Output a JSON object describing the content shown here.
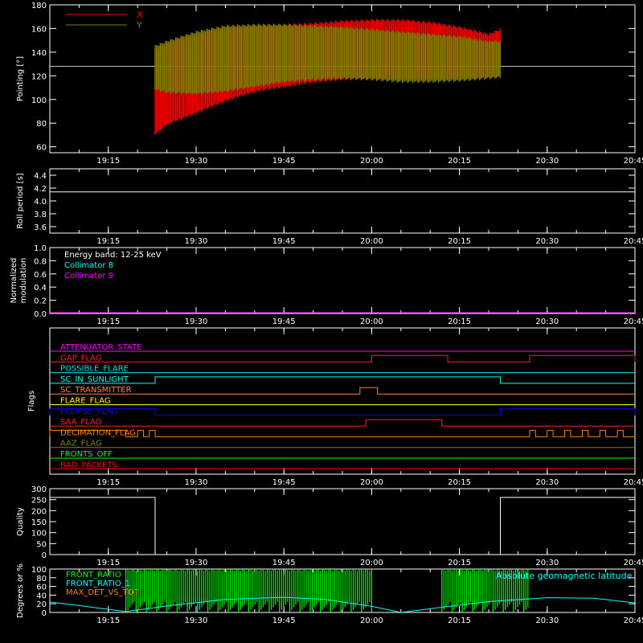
{
  "colors": {
    "background": "#000000",
    "axes": "#ffffff",
    "x_series": "#ff0000",
    "y_series": "#808000",
    "cyan": "#00ffff",
    "magenta": "#ff00ff",
    "green": "#00ff00",
    "orange": "#ff8000"
  },
  "time_axis": {
    "ticks": [
      "19:15",
      "19:30",
      "19:45",
      "20:00",
      "20:15",
      "20:30",
      "20:45"
    ]
  },
  "chart_data": [
    {
      "type": "area",
      "id": "pointing",
      "ylabel": "Pointing [°]",
      "ylim": [
        55,
        180
      ],
      "yticks": [
        60,
        80,
        100,
        120,
        140,
        160,
        180
      ],
      "legend": [
        "X",
        "Y"
      ],
      "reference_line": 128,
      "data_span": [
        "19:23",
        "20:22"
      ],
      "series": [
        {
          "name": "X",
          "color": "#ff0000",
          "x": [
            "19:23",
            "19:25",
            "19:30",
            "19:35",
            "19:40",
            "19:45",
            "19:50",
            "19:55",
            "20:00",
            "20:05",
            "20:10",
            "20:15",
            "20:20",
            "20:22"
          ],
          "low": [
            70,
            78,
            88,
            98,
            106,
            110,
            114,
            116,
            117,
            117,
            117,
            117,
            118,
            118
          ],
          "high": [
            143,
            148,
            156,
            161,
            163,
            164,
            165,
            167,
            168,
            168,
            166,
            162,
            156,
            160
          ]
        },
        {
          "name": "Y",
          "color": "#808000",
          "x": [
            "19:23",
            "19:25",
            "19:30",
            "19:35",
            "19:40",
            "19:45",
            "19:50",
            "19:55",
            "20:00",
            "20:05",
            "20:10",
            "20:15",
            "20:20",
            "20:22"
          ],
          "low": [
            108,
            105,
            104,
            106,
            110,
            114,
            116,
            117,
            116,
            114,
            114,
            115,
            117,
            118
          ],
          "high": [
            146,
            150,
            158,
            163,
            164,
            164,
            163,
            162,
            160,
            158,
            156,
            154,
            150,
            150
          ]
        }
      ]
    },
    {
      "type": "line",
      "id": "roll_period",
      "ylabel": "Roll period [s]",
      "ylim": [
        3.5,
        4.5
      ],
      "yticks": [
        "3.6",
        "3.8",
        "4.0",
        "4.2",
        "4.4"
      ],
      "series": [
        {
          "x": [
            "19:05",
            "20:45"
          ],
          "y": [
            4.14,
            4.14
          ]
        }
      ]
    },
    {
      "type": "line",
      "id": "modulation",
      "ylabel": "Normalized modulation",
      "ylim": [
        0,
        1
      ],
      "yticks": [
        "0.0",
        "0.2",
        "0.4",
        "0.6",
        "0.8",
        "1.0"
      ],
      "legend": [
        "Energy band: 12-25 keV",
        "Collimator 8",
        "Collimator 9"
      ],
      "series": [
        {
          "name": "Collimator 8",
          "color": "#00ffff",
          "x": [
            "19:05",
            "20:45"
          ],
          "y": [
            0,
            0
          ]
        },
        {
          "name": "Collimator 9",
          "color": "#ff00ff",
          "x": [
            "19:05",
            "20:45"
          ],
          "y": [
            0,
            0
          ]
        }
      ]
    },
    {
      "type": "line",
      "id": "flags",
      "ylabel": "Flags",
      "flags": [
        {
          "name": "ATTENUATOR_STATE",
          "color": "#ff00ff",
          "high": []
        },
        {
          "name": "GAP_FLAG",
          "color": "#ff2020",
          "high": [
            [
              "20:00",
              "20:13"
            ],
            [
              "20:27",
              "20:45"
            ]
          ]
        },
        {
          "name": "POSSIBLE_FLARE",
          "color": "#00e0e0",
          "high": []
        },
        {
          "name": "SC_IN_SUNLIGHT",
          "color": "#00ffff",
          "high": [
            [
              "19:23",
              "20:22"
            ]
          ]
        },
        {
          "name": "SC_TRANSMITTER",
          "color": "#ff8040",
          "high": [
            [
              "19:58",
              "20:01"
            ]
          ]
        },
        {
          "name": "FLARE_FLAG",
          "color": "#ffff00",
          "high": []
        },
        {
          "name": "ECLIPSE_FLAG",
          "color": "#0000ff",
          "high": [
            [
              "19:05",
              "19:23"
            ],
            [
              "20:22",
              "20:45"
            ]
          ]
        },
        {
          "name": "SAA_FLAG",
          "color": "#ff2020",
          "high": [
            [
              "19:59",
              "20:12"
            ]
          ]
        },
        {
          "name": "DECIMATION_FLAG",
          "color": "#ff8000",
          "high": [
            [
              "19:05",
              "19:18"
            ],
            [
              "19:20",
              "19:21"
            ],
            [
              "19:22",
              "19:23"
            ],
            [
              "20:27",
              "20:28"
            ],
            [
              "20:30",
              "20:31"
            ],
            [
              "20:33",
              "20:34"
            ],
            [
              "20:36",
              "20:37"
            ],
            [
              "20:39",
              "20:40"
            ],
            [
              "20:42",
              "20:43"
            ]
          ]
        },
        {
          "name": "AAZ_FLAG",
          "color": "#808000",
          "high": []
        },
        {
          "name": "FRONTS_OFF",
          "color": "#00ff00",
          "high": []
        },
        {
          "name": "BAD_PACKETS",
          "color": "#ff0000",
          "high": []
        }
      ]
    },
    {
      "type": "line",
      "id": "quality",
      "ylabel": "Quality",
      "ylim": [
        0,
        300
      ],
      "yticks": [
        "0",
        "50",
        "100",
        "150",
        "200",
        "250",
        "300"
      ],
      "series": [
        {
          "x": [
            "19:05",
            "19:23",
            "19:23",
            "20:22",
            "20:22",
            "20:45"
          ],
          "y": [
            260,
            260,
            0,
            0,
            260,
            260
          ]
        }
      ]
    },
    {
      "type": "line",
      "id": "ratios",
      "ylabel": "Degrees or %",
      "ylim": [
        0,
        100
      ],
      "yticks": [
        "0",
        "20",
        "40",
        "60",
        "80",
        "100"
      ],
      "legend": [
        "FRONT_RATIO",
        "FRONT_RATIO_1",
        "MAX_DET_VS_TOT"
      ],
      "annotation": "Absolute geomagnetic latitude",
      "green_bursts": [
        [
          "19:18",
          "20:00"
        ],
        [
          "20:12",
          "20:27"
        ]
      ],
      "series": [
        {
          "name": "Absolute geomagnetic latitude",
          "color": "#00ffff",
          "x": [
            "19:05",
            "19:10",
            "19:18",
            "19:25",
            "19:35",
            "19:45",
            "19:52",
            "20:00",
            "20:05",
            "20:12",
            "20:20",
            "20:30",
            "20:38",
            "20:45"
          ],
          "y": [
            24,
            16,
            2,
            15,
            30,
            35,
            30,
            14,
            0,
            12,
            25,
            34,
            33,
            22
          ]
        }
      ]
    }
  ]
}
